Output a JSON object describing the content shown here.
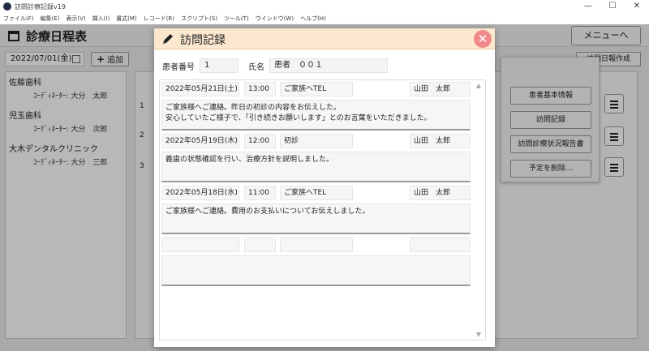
{
  "window": {
    "title": "訪問診療記録v19",
    "controls": [
      "—",
      "☐",
      "✕"
    ]
  },
  "menubar": [
    "ファイル(F)",
    "編集(E)",
    "表示(V)",
    "挿入(I)",
    "書式(M)",
    "レコード(R)",
    "スクリプト(S)",
    "ツール(T)",
    "ウインドウ(W)",
    "ヘルプ(H)"
  ],
  "app": {
    "title": "診療日程表",
    "menu_button": "メニューへ",
    "date": "2022/07/01(金)",
    "add_button": "追加",
    "report_button": "訪問日報作成",
    "clinics": [
      {
        "name": "佐藤歯科",
        "coordinator": "ｺｰﾃﾞｨﾈｰﾀｰ: 大分　太郎"
      },
      {
        "name": "児玉歯科",
        "coordinator": "ｺｰﾃﾞｨﾈｰﾀｰ: 大分　次郎"
      },
      {
        "name": "大木デンタルクリニック",
        "coordinator": "ｺｰﾃﾞｨﾈｰﾀｰ: 大分　三郎"
      }
    ],
    "row_numbers": [
      "1",
      "2",
      "3"
    ],
    "context_menu": [
      "患者基本情報",
      "訪問記録",
      "訪問診療状況報告書",
      "予定を削除…"
    ]
  },
  "modal": {
    "title": "訪問記録",
    "close": "✕",
    "patient_no_label": "患者番号",
    "patient_no": "1",
    "name_label": "氏名",
    "name": "患者　００１",
    "records": [
      {
        "date": "2022年05月21日(土)",
        "time": "13:00",
        "type": "ご家族へTEL",
        "staff": "山田　太郎",
        "lines": [
          "ご家族様へご連絡。昨日の初診の内容をお伝えした。",
          "安心していたご様子で、「引き続きお願いします」とのお言葉をいただきました。"
        ]
      },
      {
        "date": "2022年05月19日(木)",
        "time": "12:00",
        "type": "初診",
        "staff": "山田　太郎",
        "lines": [
          "義歯の状態確認を行い、治療方針を説明しました。",
          ""
        ]
      },
      {
        "date": "2022年05月18日(水)",
        "time": "11:00",
        "type": "ご家族へTEL",
        "staff": "山田　太郎",
        "lines": [
          "ご家族様へご連絡。費用のお支払いについてお伝えしました。",
          ""
        ]
      },
      {
        "date": "",
        "time": "",
        "type": "",
        "staff": "",
        "lines": [
          "",
          ""
        ]
      }
    ]
  },
  "colors": {
    "modal_header": "#fce8cf",
    "close_button": "#f08a8a"
  }
}
